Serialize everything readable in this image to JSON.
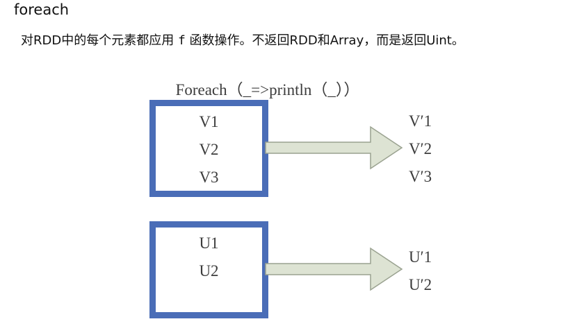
{
  "heading": "foreach",
  "description": {
    "part1": "对RDD中的每个元素都应用 ",
    "code_f": "f",
    "part2": " 函数操作。不返回RDD和Array，而是返回Uint。"
  },
  "diagram": {
    "caption": "Foreach（_=>println（_））",
    "groups": [
      {
        "inputs": [
          "V1",
          "V2",
          "V3"
        ],
        "outputs": [
          "V′1",
          "V′2",
          "V′3"
        ]
      },
      {
        "inputs": [
          "U1",
          "U2"
        ],
        "outputs": [
          "U′1",
          "U′2"
        ]
      }
    ]
  },
  "colors": {
    "box_border": "#4a6db7",
    "arrow_fill": "#dde3d3",
    "arrow_stroke": "#9aa290",
    "label_text": "#3c3c3c"
  }
}
